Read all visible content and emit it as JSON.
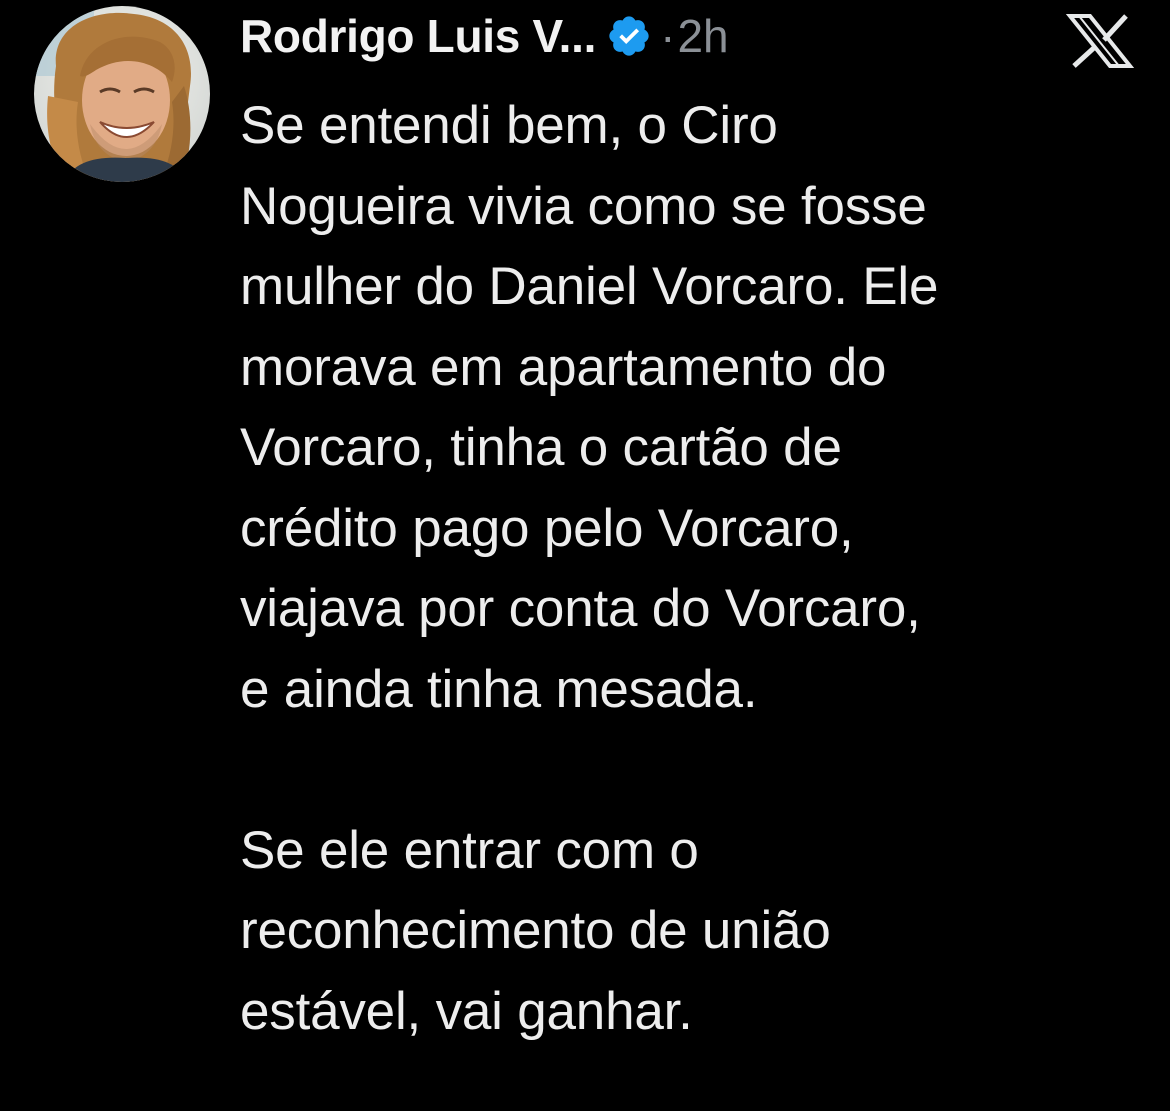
{
  "tweet": {
    "author_name": "Rodrigo Luis V...",
    "verified_badge_color": "#1d9bf0",
    "dot": "·",
    "timestamp": "2h",
    "platform_icon": "x-logo-icon",
    "paragraphs": [
      {
        "lines": [
          "Se entendi bem, o Ciro",
          "Nogueira vivia como se fosse",
          "mulher do Daniel Vorcaro. Ele",
          "morava em apartamento do",
          "Vorcaro, tinha o cartão de",
          "crédito pago pelo Vorcaro,",
          "viajava por conta do Vorcaro,",
          "e ainda tinha mesada."
        ]
      },
      {
        "lines": [
          "Se ele entrar com o",
          "reconhecimento de união",
          "estável, vai ganhar."
        ]
      }
    ]
  },
  "colors": {
    "background": "#000000",
    "text": "#e7e9ea",
    "muted": "#8b9096"
  }
}
